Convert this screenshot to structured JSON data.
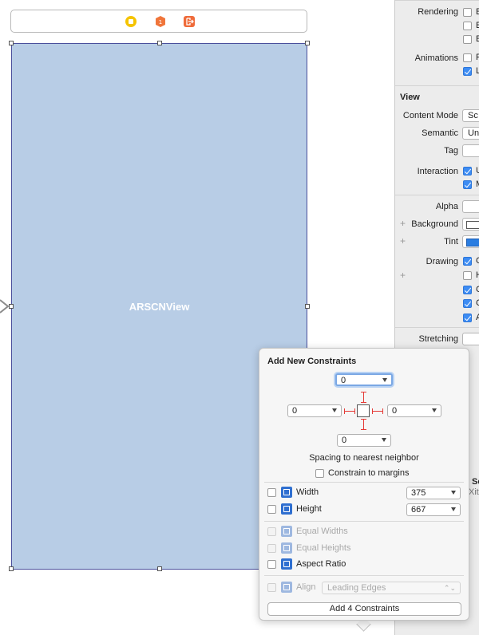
{
  "canvas": {
    "view_label": "ARSCNView",
    "scene_bar_icons": [
      "view-controller-icon",
      "first-responder-icon",
      "exit-icon"
    ]
  },
  "inspector": {
    "rendering_label": "Rendering",
    "rendering_options": [
      {
        "text": "E",
        "checked": false
      },
      {
        "text": "E",
        "checked": false
      },
      {
        "text": "E",
        "checked": false
      }
    ],
    "animations_label": "Animations",
    "animations_options": [
      {
        "text": "P",
        "checked": false
      },
      {
        "text": "L",
        "checked": true
      }
    ],
    "view_section": "View",
    "content_mode_label": "Content Mode",
    "content_mode_value": "Sc",
    "semantic_label": "Semantic",
    "semantic_value": "Un",
    "tag_label": "Tag",
    "interaction_label": "Interaction",
    "interaction_options": [
      {
        "text": "U",
        "checked": true
      },
      {
        "text": "M",
        "checked": true
      }
    ],
    "alpha_label": "Alpha",
    "background_label": "Background",
    "tint_label": "Tint",
    "tint_color": "#2a7de1",
    "drawing_label": "Drawing",
    "drawing_options": [
      {
        "text": "O",
        "checked": true
      },
      {
        "text": "H",
        "checked": false
      },
      {
        "text": "C",
        "checked": true
      },
      {
        "text": "C",
        "checked": true
      },
      {
        "text": "A",
        "checked": true
      }
    ],
    "stretching_label": "Stretching",
    "partial_text_1": "Sc",
    "partial_text_2": "Xit"
  },
  "popover": {
    "title": "Add New Constraints",
    "top_value": "0",
    "left_value": "0",
    "right_value": "0",
    "bottom_value": "0",
    "spacing_label": "Spacing to nearest neighbor",
    "constrain_margins_label": "Constrain to margins",
    "width_label": "Width",
    "width_value": "375",
    "height_label": "Height",
    "height_value": "667",
    "equal_widths_label": "Equal Widths",
    "equal_heights_label": "Equal Heights",
    "aspect_ratio_label": "Aspect Ratio",
    "align_label": "Align",
    "align_value": "Leading Edges",
    "add_button_label": "Add 4 Constraints",
    "accent_color": "#e53935"
  }
}
